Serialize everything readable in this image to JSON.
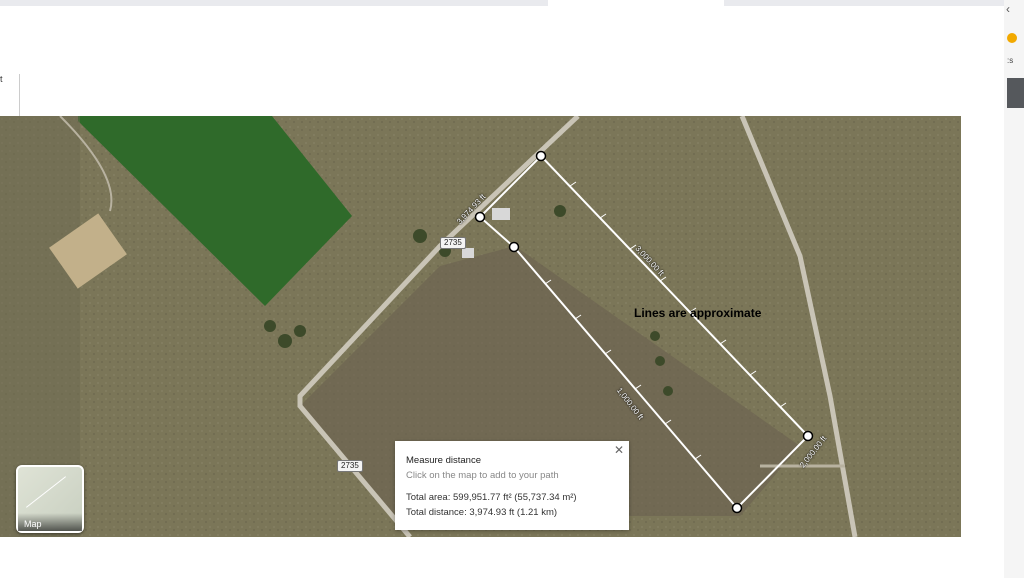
{
  "map": {
    "annotation": "Lines are approximate",
    "route_shields": [
      "2735",
      "2735"
    ],
    "segment_labels": {
      "top_short": "3,974.93 ft",
      "long_right": "3,000.00 ft",
      "long_left": "1,000.00 ft",
      "bottom_right": "2,000.00 ft"
    },
    "map_type_button": "Map"
  },
  "measure_panel": {
    "title": "Measure distance",
    "hint": "Click on the map to add to your path",
    "total_area": "Total area: 599,951.77 ft² (55,737.34 m²)",
    "total_distance": "Total distance: 3,974.93 ft (1.21 km)",
    "close_icon": "close-icon"
  },
  "colors": {
    "field_green": "#2f6a2a",
    "terrain": "#7a7457",
    "road": "#c9c4b6",
    "path": "#ffffff"
  }
}
